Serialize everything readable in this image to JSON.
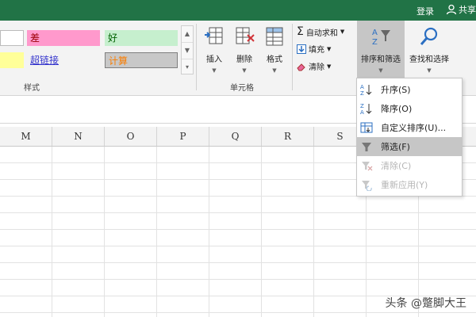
{
  "topbar": {
    "login": "登录",
    "share": "共享"
  },
  "styles": {
    "bad": "差",
    "good": "好",
    "hyperlink": "超链接",
    "calc": "计算",
    "group_label": "样式",
    "colors": {
      "bad_bg": "#ff99cc",
      "good_bg": "#c6efce",
      "calc_bg": "#c8c8c8",
      "calc_text": "#fa7d00",
      "neutral_bg": "#ffff99",
      "link": "#3333cc"
    }
  },
  "cells_group": {
    "insert": "插入",
    "delete": "删除",
    "format": "格式",
    "group_label": "单元格"
  },
  "editing": {
    "autosum": "自动求和",
    "fill": "填充",
    "clear": "清除",
    "sort_filter": "排序和筛选",
    "find_select": "查找和选择"
  },
  "columns": [
    "M",
    "N",
    "O",
    "P",
    "Q",
    "R",
    "S"
  ],
  "menu": {
    "items": [
      {
        "label": "升序(S)",
        "icon": "sort-ascending-icon",
        "state": "normal"
      },
      {
        "label": "降序(O)",
        "icon": "sort-descending-icon",
        "state": "normal"
      },
      {
        "label": "自定义排序(U)...",
        "icon": "custom-sort-icon",
        "state": "normal"
      },
      {
        "label": "筛选(F)",
        "icon": "filter-icon",
        "state": "highlighted"
      },
      {
        "label": "清除(C)",
        "icon": "clear-filter-icon",
        "state": "disabled"
      },
      {
        "label": "重新应用(Y)",
        "icon": "reapply-icon",
        "state": "disabled"
      }
    ]
  },
  "watermark": "头条 @蹩脚大王",
  "theme": {
    "accent": "#217346"
  }
}
